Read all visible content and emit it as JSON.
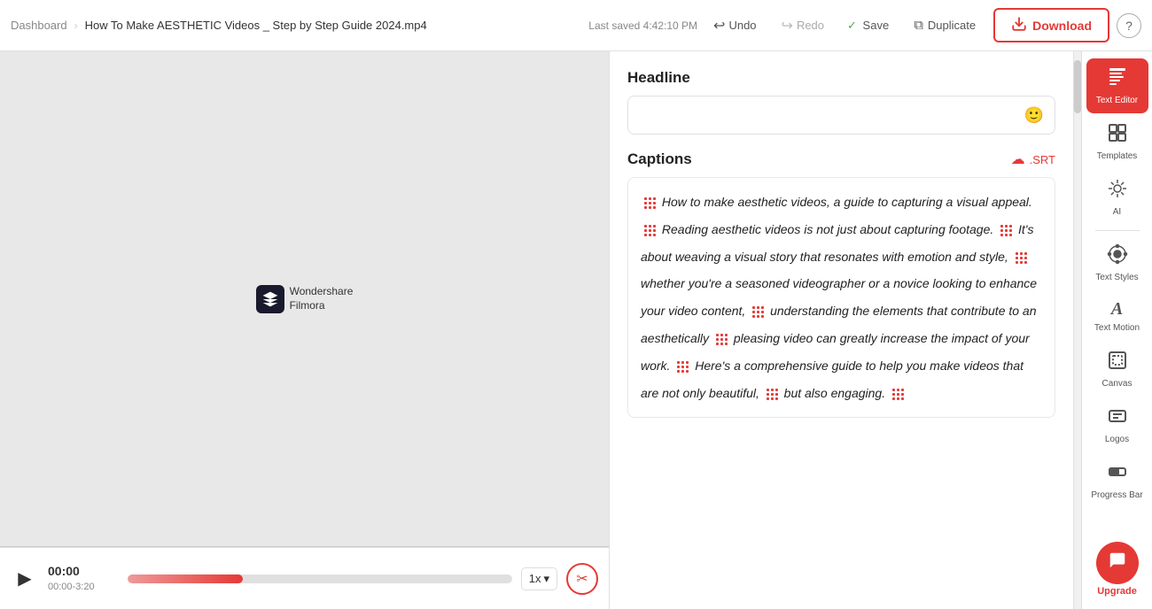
{
  "topbar": {
    "dashboard": "Dashboard",
    "separator": "→",
    "filename": "How To Make AESTHETIC Videos _ Step by Step Guide 2024.mp4",
    "last_saved": "Last saved 4:42:10 PM",
    "undo": "Undo",
    "redo": "Redo",
    "save": "Save",
    "duplicate": "Duplicate",
    "download": "Download",
    "help_icon": "?"
  },
  "video": {
    "watermark_brand": "Wondershare",
    "watermark_product": "Filmora"
  },
  "controls": {
    "time_current": "00:00",
    "time_total": "00:00-3:20",
    "speed": "1x",
    "progress_percent": 30
  },
  "editor": {
    "headline_label": "Headline",
    "headline_placeholder": "",
    "captions_label": "Captions",
    "srt_label": ".SRT",
    "caption_text": "How to make aesthetic videos, a guide to capturing a visual appeal. Reading aesthetic videos is not just about capturing footage. It's about weaving a visual story that resonates with emotion and style, whether you're a seasoned videographer or a novice looking to enhance your video content, understanding the elements that contribute to an aesthetically pleasing video can greatly increase the impact of your work. Here's a comprehensive guide to help you make videos that are not only beautiful, but also engaging."
  },
  "sidebar": {
    "items": [
      {
        "id": "text-editor",
        "label": "Text Editor",
        "icon": "⌨",
        "active": true
      },
      {
        "id": "templates",
        "label": "Templates",
        "icon": "⊞",
        "active": false
      },
      {
        "id": "ai",
        "label": "AI",
        "icon": "✦",
        "active": false
      },
      {
        "id": "text-styles",
        "label": "Text Styles",
        "icon": "🎨",
        "active": false
      },
      {
        "id": "text-motion",
        "label": "Text Motion",
        "icon": "A",
        "active": false
      },
      {
        "id": "canvas",
        "label": "Canvas",
        "icon": "⬚",
        "active": false
      },
      {
        "id": "logos",
        "label": "Logos",
        "icon": "L",
        "active": false
      },
      {
        "id": "progress-bar",
        "label": "Progress Bar",
        "icon": "▬",
        "active": false
      }
    ],
    "upgrade_label": "Upgrade"
  },
  "colors": {
    "accent": "#e53935",
    "border": "#e0e0e0",
    "text_primary": "#222222",
    "text_muted": "#888888"
  }
}
